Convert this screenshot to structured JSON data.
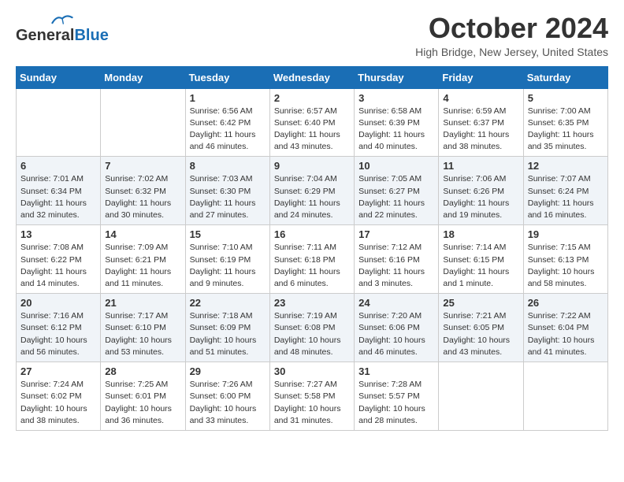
{
  "header": {
    "logo_line1": "General",
    "logo_line2": "Blue",
    "month_title": "October 2024",
    "location": "High Bridge, New Jersey, United States"
  },
  "days_of_week": [
    "Sunday",
    "Monday",
    "Tuesday",
    "Wednesday",
    "Thursday",
    "Friday",
    "Saturday"
  ],
  "weeks": [
    [
      {
        "day": "",
        "info": ""
      },
      {
        "day": "",
        "info": ""
      },
      {
        "day": "1",
        "info": "Sunrise: 6:56 AM\nSunset: 6:42 PM\nDaylight: 11 hours and 46 minutes."
      },
      {
        "day": "2",
        "info": "Sunrise: 6:57 AM\nSunset: 6:40 PM\nDaylight: 11 hours and 43 minutes."
      },
      {
        "day": "3",
        "info": "Sunrise: 6:58 AM\nSunset: 6:39 PM\nDaylight: 11 hours and 40 minutes."
      },
      {
        "day": "4",
        "info": "Sunrise: 6:59 AM\nSunset: 6:37 PM\nDaylight: 11 hours and 38 minutes."
      },
      {
        "day": "5",
        "info": "Sunrise: 7:00 AM\nSunset: 6:35 PM\nDaylight: 11 hours and 35 minutes."
      }
    ],
    [
      {
        "day": "6",
        "info": "Sunrise: 7:01 AM\nSunset: 6:34 PM\nDaylight: 11 hours and 32 minutes."
      },
      {
        "day": "7",
        "info": "Sunrise: 7:02 AM\nSunset: 6:32 PM\nDaylight: 11 hours and 30 minutes."
      },
      {
        "day": "8",
        "info": "Sunrise: 7:03 AM\nSunset: 6:30 PM\nDaylight: 11 hours and 27 minutes."
      },
      {
        "day": "9",
        "info": "Sunrise: 7:04 AM\nSunset: 6:29 PM\nDaylight: 11 hours and 24 minutes."
      },
      {
        "day": "10",
        "info": "Sunrise: 7:05 AM\nSunset: 6:27 PM\nDaylight: 11 hours and 22 minutes."
      },
      {
        "day": "11",
        "info": "Sunrise: 7:06 AM\nSunset: 6:26 PM\nDaylight: 11 hours and 19 minutes."
      },
      {
        "day": "12",
        "info": "Sunrise: 7:07 AM\nSunset: 6:24 PM\nDaylight: 11 hours and 16 minutes."
      }
    ],
    [
      {
        "day": "13",
        "info": "Sunrise: 7:08 AM\nSunset: 6:22 PM\nDaylight: 11 hours and 14 minutes."
      },
      {
        "day": "14",
        "info": "Sunrise: 7:09 AM\nSunset: 6:21 PM\nDaylight: 11 hours and 11 minutes."
      },
      {
        "day": "15",
        "info": "Sunrise: 7:10 AM\nSunset: 6:19 PM\nDaylight: 11 hours and 9 minutes."
      },
      {
        "day": "16",
        "info": "Sunrise: 7:11 AM\nSunset: 6:18 PM\nDaylight: 11 hours and 6 minutes."
      },
      {
        "day": "17",
        "info": "Sunrise: 7:12 AM\nSunset: 6:16 PM\nDaylight: 11 hours and 3 minutes."
      },
      {
        "day": "18",
        "info": "Sunrise: 7:14 AM\nSunset: 6:15 PM\nDaylight: 11 hours and 1 minute."
      },
      {
        "day": "19",
        "info": "Sunrise: 7:15 AM\nSunset: 6:13 PM\nDaylight: 10 hours and 58 minutes."
      }
    ],
    [
      {
        "day": "20",
        "info": "Sunrise: 7:16 AM\nSunset: 6:12 PM\nDaylight: 10 hours and 56 minutes."
      },
      {
        "day": "21",
        "info": "Sunrise: 7:17 AM\nSunset: 6:10 PM\nDaylight: 10 hours and 53 minutes."
      },
      {
        "day": "22",
        "info": "Sunrise: 7:18 AM\nSunset: 6:09 PM\nDaylight: 10 hours and 51 minutes."
      },
      {
        "day": "23",
        "info": "Sunrise: 7:19 AM\nSunset: 6:08 PM\nDaylight: 10 hours and 48 minutes."
      },
      {
        "day": "24",
        "info": "Sunrise: 7:20 AM\nSunset: 6:06 PM\nDaylight: 10 hours and 46 minutes."
      },
      {
        "day": "25",
        "info": "Sunrise: 7:21 AM\nSunset: 6:05 PM\nDaylight: 10 hours and 43 minutes."
      },
      {
        "day": "26",
        "info": "Sunrise: 7:22 AM\nSunset: 6:04 PM\nDaylight: 10 hours and 41 minutes."
      }
    ],
    [
      {
        "day": "27",
        "info": "Sunrise: 7:24 AM\nSunset: 6:02 PM\nDaylight: 10 hours and 38 minutes."
      },
      {
        "day": "28",
        "info": "Sunrise: 7:25 AM\nSunset: 6:01 PM\nDaylight: 10 hours and 36 minutes."
      },
      {
        "day": "29",
        "info": "Sunrise: 7:26 AM\nSunset: 6:00 PM\nDaylight: 10 hours and 33 minutes."
      },
      {
        "day": "30",
        "info": "Sunrise: 7:27 AM\nSunset: 5:58 PM\nDaylight: 10 hours and 31 minutes."
      },
      {
        "day": "31",
        "info": "Sunrise: 7:28 AM\nSunset: 5:57 PM\nDaylight: 10 hours and 28 minutes."
      },
      {
        "day": "",
        "info": ""
      },
      {
        "day": "",
        "info": ""
      }
    ]
  ]
}
